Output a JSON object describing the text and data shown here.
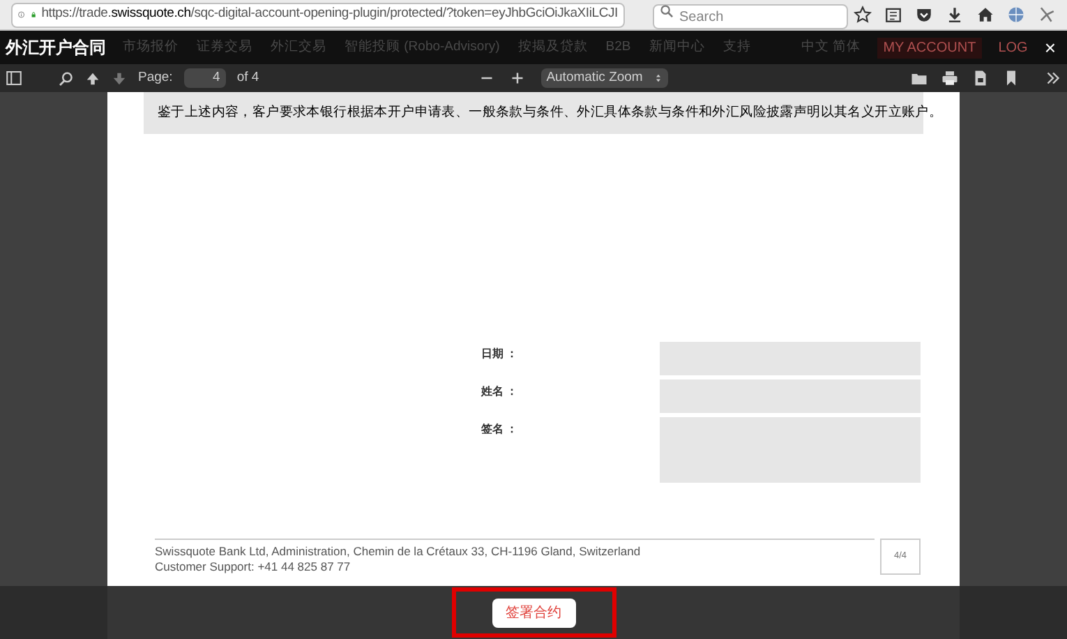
{
  "browser": {
    "url": "https://trade.**swissquote.ch**/sqc-digital-account-opening-plugin/protected/?token=eyJhbGciOiJkaXIiLCJI",
    "search": {
      "placeholder": "Search"
    }
  },
  "site_nav": {
    "items": [
      "市场报价",
      "证券交易",
      "外汇交易",
      "智能投顾 (Robo-Advisory)",
      "按揭及贷款",
      "B2B",
      "新闻中心",
      "支持"
    ],
    "language": "中文 简体",
    "account": "MY ACCOUNT",
    "login": "LOG"
  },
  "modal": {
    "title": "外汇开户合同",
    "close": "×"
  },
  "pdf_toolbar": {
    "page_label": "Page:",
    "page": "4",
    "page_count": "of 4",
    "zoom": "Automatic Zoom"
  },
  "document": {
    "statement": "鉴于上述内容，客户要求本银行根据本开户申请表、一般条款与条件、外汇具体条款与条件和外汇风险披露声明以其名义开立账户。",
    "fields": [
      {
        "label": "日期 ：",
        "kind": "line"
      },
      {
        "label": "姓名 ：",
        "kind": "line"
      },
      {
        "label": "签名 ：",
        "kind": "signature"
      }
    ],
    "footer": [
      "Swissquote Bank Ltd, Administration, Chemin de la Crétaux 33, CH-1196 Gland, Switzerland",
      "Customer Support: +41 44 825 87 77"
    ],
    "page_number": "4/4"
  },
  "action": {
    "label": "签署合约"
  }
}
